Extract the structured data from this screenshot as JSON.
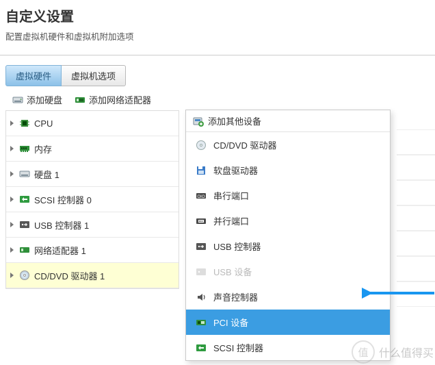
{
  "header": {
    "title": "自定义设置",
    "subtitle": "配置虚拟机硬件和虚拟机附加选项"
  },
  "tabs": {
    "hardware": "虚拟硬件",
    "options": "虚拟机选项"
  },
  "toolbar": {
    "add_disk": "添加硬盘",
    "add_nic": "添加网络适配器",
    "add_other": "添加其他设备"
  },
  "hardware_list": [
    {
      "label": "CPU"
    },
    {
      "label": "内存"
    },
    {
      "label": "硬盘 1"
    },
    {
      "label": "SCSI 控制器 0"
    },
    {
      "label": "USB 控制器 1"
    },
    {
      "label": "网络适配器 1"
    },
    {
      "label": "CD/DVD 驱动器 1"
    }
  ],
  "dropdown": {
    "items": [
      {
        "label": "CD/DVD 驱动器"
      },
      {
        "label": "软盘驱动器"
      },
      {
        "label": "串行端口"
      },
      {
        "label": "并行端口"
      },
      {
        "label": "USB 控制器"
      },
      {
        "label": "USB 设备"
      },
      {
        "label": "声音控制器"
      },
      {
        "label": "PCI 设备"
      },
      {
        "label": "SCSI 控制器"
      }
    ]
  },
  "watermark": "什么值得买"
}
